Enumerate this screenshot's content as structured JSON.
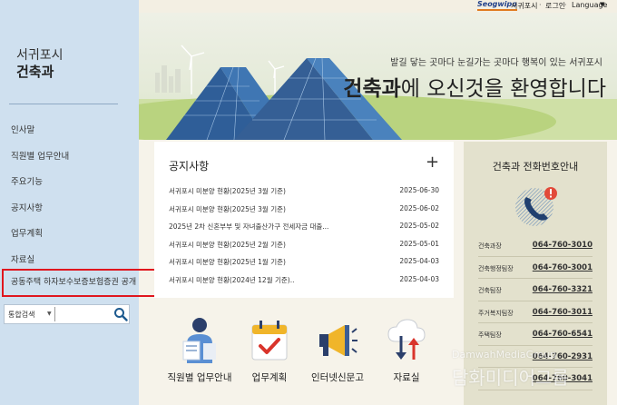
{
  "topbar": {
    "logo_text": "Seogwipo",
    "city": "서귀포시",
    "separator": "·",
    "login": "로그인",
    "language": "Language"
  },
  "sidebar": {
    "dept_city": "서귀포시",
    "dept_name": "건축과",
    "menu": [
      {
        "label": "인사말"
      },
      {
        "label": "직원별 업무안내"
      },
      {
        "label": "주요기능"
      },
      {
        "label": "공지사항"
      },
      {
        "label": "업무계획"
      },
      {
        "label": "자료실"
      }
    ],
    "highlighted_item": "공동주택 하자보수보증보험증권 공개",
    "search": {
      "label": "통합검색",
      "value": ""
    }
  },
  "hero": {
    "subtitle": "발길 닿는 곳마다 눈길가는 곳마다 행복이 있는 서귀포시",
    "title_bold": "건축과",
    "title_rest": "에 오신것을 환영합니다"
  },
  "notice": {
    "title": "공지사항",
    "more": "+",
    "items": [
      {
        "title": "서귀포시 미분양 현황(2025년 3월 기준)",
        "date": "2025-06-30"
      },
      {
        "title": "서귀포시 미분양 현황(2025년 3월 기준)",
        "date": "2025-06-02"
      },
      {
        "title": "2025년 2차 신혼부부 및 자녀출산가구 전세자금 대출...",
        "date": "2025-05-02"
      },
      {
        "title": "서귀포시 미분양 현황(2025년 2월 기준)",
        "date": "2025-05-01"
      },
      {
        "title": "서귀포시 미분양 현황(2025년 1월 기준)",
        "date": "2025-04-03"
      },
      {
        "title": "서귀포시 미분양 현황(2024년 12월 기준)..",
        "date": "2025-04-03"
      }
    ]
  },
  "phone": {
    "title": "건축과 전화번호안내",
    "items": [
      {
        "label": "건축과장",
        "number": "064-760-3010"
      },
      {
        "label": "건축행정팀장",
        "number": "064-760-3001"
      },
      {
        "label": "건축팀장",
        "number": "064-760-3321"
      },
      {
        "label": "주거복지팀장",
        "number": "064-760-3011"
      },
      {
        "label": "주택팀장",
        "number": "064-760-6541"
      },
      {
        "label": "",
        "number": "064-760-2931"
      },
      {
        "label": "",
        "number": "064-760-3041"
      }
    ]
  },
  "quicklinks": [
    {
      "label": "직원별 업무안내"
    },
    {
      "label": "업무계획"
    },
    {
      "label": "인터넷신문고"
    },
    {
      "label": "자료실"
    }
  ],
  "watermark": {
    "en": "DamwahMediaGroup",
    "ko": "담화미디어그룹"
  },
  "colors": {
    "sidebar_bg": "#cfe0ef",
    "highlight_border": "#e0161e",
    "phone_panel_bg": "#e3e1cd",
    "accent_blue": "#1f3f8a"
  }
}
